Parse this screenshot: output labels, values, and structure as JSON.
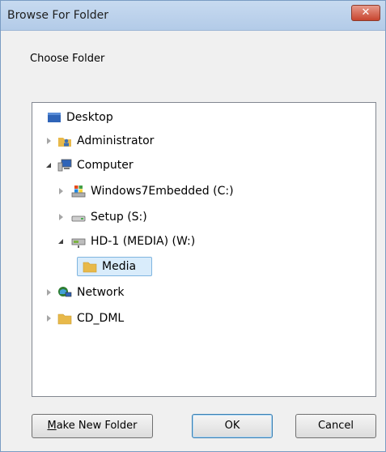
{
  "dialog": {
    "title": "Browse For Folder",
    "close_label": "✕",
    "prompt": "Choose Folder"
  },
  "tree": {
    "items": [
      {
        "label": "Desktop",
        "icon": "desktop-icon",
        "level": 0,
        "expander": "none"
      },
      {
        "label": "Administrator",
        "icon": "user-folder-icon",
        "level": 1,
        "expander": "collapsed"
      },
      {
        "label": "Computer",
        "icon": "computer-icon",
        "level": 1,
        "expander": "expanded"
      },
      {
        "label": "Windows7Embedded (C:)",
        "icon": "system-drive-icon",
        "level": 2,
        "expander": "collapsed"
      },
      {
        "label": "Setup (S:)",
        "icon": "drive-icon",
        "level": 2,
        "expander": "collapsed"
      },
      {
        "label": "HD-1 (MEDIA) (W:)",
        "icon": "network-drive-icon",
        "level": 2,
        "expander": "expanded"
      },
      {
        "label": "Media",
        "icon": "folder-icon",
        "level": 3,
        "expander": "none",
        "selected": true
      },
      {
        "label": "Network",
        "icon": "network-icon",
        "level": 1,
        "expander": "collapsed"
      },
      {
        "label": "CD_DML",
        "icon": "folder-icon",
        "level": 1,
        "expander": "collapsed"
      }
    ]
  },
  "buttons": {
    "make_new_folder_mnemonic": "M",
    "make_new_folder_rest": "ake New Folder",
    "ok": "OK",
    "cancel": "Cancel"
  },
  "colors": {
    "folder": "#e8b94a",
    "selection": "#d9ecfb",
    "title_bar": "#b9cfea",
    "close_button": "#c8452f"
  }
}
